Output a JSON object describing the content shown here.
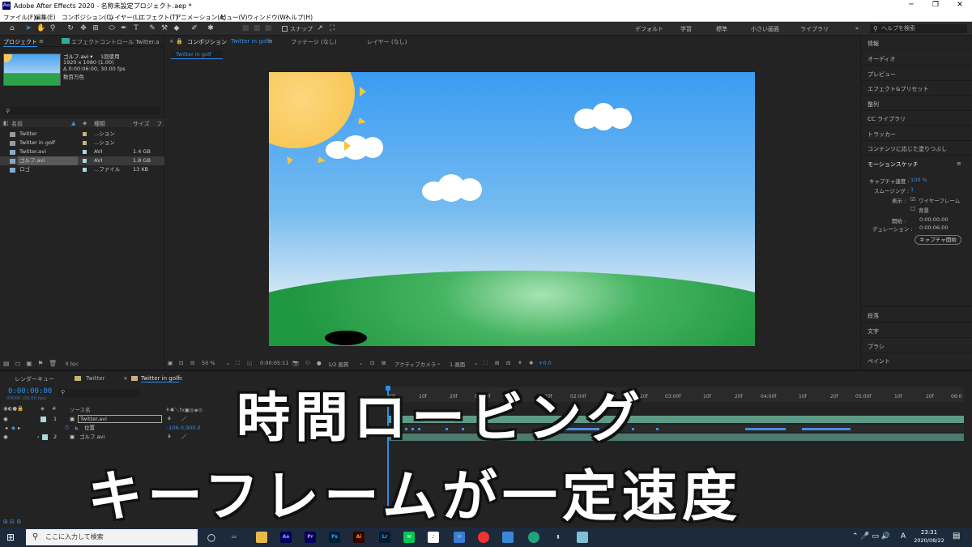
{
  "window": {
    "title": "Adobe After Effects 2020 - 名称未設定プロジェクト.aep *",
    "app_badge": "Ae"
  },
  "menu": [
    "ファイル(F)",
    "編集(E)",
    "コンポジション(C)",
    "レイヤー(L)",
    "エフェクト(T)",
    "アニメーション(A)",
    "ビュー(V)",
    "ウィンドウ(W)",
    "ヘルプ(H)"
  ],
  "toolbar": {
    "snap_label": "スナップ",
    "workspaces": [
      "デフォルト",
      "学習",
      "標準",
      "小さい画面",
      "ライブラリ"
    ],
    "search_placeholder": "ヘルプを検索"
  },
  "project": {
    "tab_label": "プロジェクト",
    "effects_tab": "エフェクトコントロール Twitter.a",
    "selected_name": "ゴルフ.avi ▾",
    "used": "1回使用",
    "dims": "1920 x 1080 (1.00)",
    "duration": "Δ 0:00:06:00, 30.00 fps",
    "colors": "数百万色",
    "columns": {
      "name": "名前",
      "type": "種類",
      "size": "サイズ"
    },
    "items": [
      {
        "name": "Twitter",
        "type": "...ション",
        "size": "",
        "label": "#c9b27a"
      },
      {
        "name": "Twitter in golf",
        "type": "...ション",
        "size": "",
        "label": "#c9b27a"
      },
      {
        "name": "Twitter.avi",
        "type": "AVI",
        "size": "1.4 GB",
        "label": "#a8d8d8"
      },
      {
        "name": "ゴルフ.avi",
        "type": "AVI",
        "size": "1.8 GB",
        "label": "#a8d8d8"
      },
      {
        "name": "ロゴ",
        "type": "...ファイル",
        "size": "13 KB",
        "label": "#a8d8d8"
      }
    ],
    "bpc": "8 bpc"
  },
  "composition": {
    "tab_label": "コンポジション",
    "comp_name": "Twitter in golf",
    "footage_tab": "フッテージ (なし)",
    "layer_tab": "レイヤー (なし)",
    "breadcrumb": "Twitter in golf"
  },
  "viewer_bar": {
    "zoom": "50 %",
    "time": "0:00:05:11",
    "resolution": "1/2 画質",
    "camera": "アクティブカメラ",
    "views": "1 画面",
    "exposure": "+0.0"
  },
  "right_panel": {
    "items": [
      "情報",
      "オーディオ",
      "プレビュー",
      "エフェクト&プリセット",
      "整列",
      "CC ライブラリ",
      "トラッカー",
      "コンテンツに応じた塗りつぶし"
    ],
    "motion_sketch": {
      "title": "モーションスケッチ",
      "capture_speed_label": "キャプチャ速度 :",
      "capture_speed": "100 %",
      "smoothing_label": "スムージング :",
      "smoothing": "1",
      "show_label": "表示 :",
      "wireframe": "ワイヤーフレーム",
      "background": "背景",
      "start_label": "開始 :",
      "start": "0:00:00:00",
      "duration_label": "デュレーション :",
      "duration": "0:00:06:00",
      "capture_button": "キャプチャ開始"
    },
    "bottom_items": [
      "段落",
      "文字",
      "ブラシ",
      "ペイント"
    ]
  },
  "timeline": {
    "tabs": [
      "レンダーキュー",
      "Twitter",
      "Twitter in golf"
    ],
    "timecode": "0:00:00:00",
    "timecode_sub": "00000 (30.00 fps)",
    "source_name_label": "ソース名",
    "ruler": [
      "00f",
      "10f",
      "20f",
      "01:00f",
      "10f",
      "20f",
      "02:00f",
      "10f",
      "20f",
      "03:00f",
      "10f",
      "20f",
      "04:00f",
      "10f",
      "20f",
      "05:00f",
      "10f",
      "20f",
      "06:0"
    ],
    "layers": [
      {
        "num": "1",
        "name": "Twitter.avi"
      },
      {
        "num": "",
        "name": "位置",
        "value": "-106.0,900.0"
      },
      {
        "num": "2",
        "name": "ゴルフ.avi"
      }
    ]
  },
  "overlay": {
    "line1": "時間ロービング",
    "line2": "キーフレームが一定速度"
  },
  "taskbar": {
    "search": "ここに入力して検索",
    "time": "23:31",
    "date": "2020/08/22",
    "ime": "A"
  }
}
